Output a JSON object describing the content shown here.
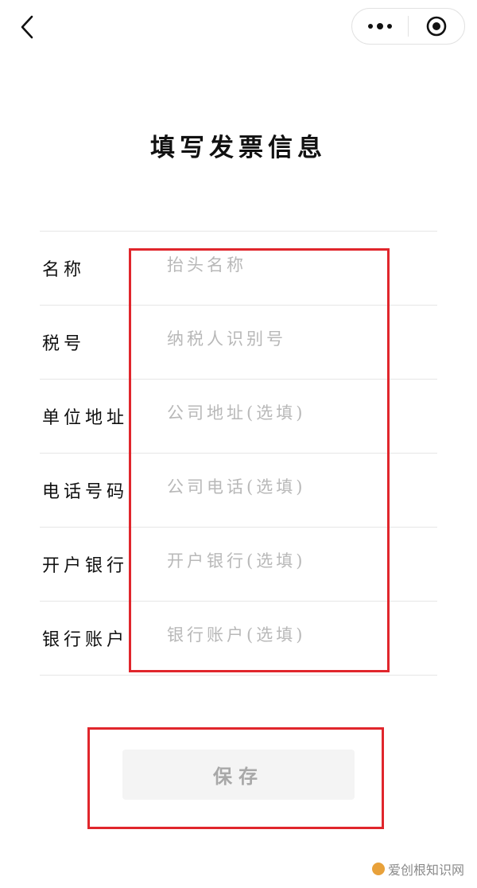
{
  "nav": {
    "back_icon": "chevron-left-icon",
    "more_icon": "more-dots-icon",
    "close_icon": "target-close-icon"
  },
  "page": {
    "title": "填写发票信息"
  },
  "form": {
    "rows": [
      {
        "label": "名称",
        "placeholder": "抬头名称",
        "value": ""
      },
      {
        "label": "税号",
        "placeholder": "纳税人识别号",
        "value": ""
      },
      {
        "label": "单位地址",
        "placeholder": "公司地址(选填)",
        "value": ""
      },
      {
        "label": "电话号码",
        "placeholder": "公司电话(选填)",
        "value": ""
      },
      {
        "label": "开户银行",
        "placeholder": "开户银行(选填)",
        "value": ""
      },
      {
        "label": "银行账户",
        "placeholder": "银行账户(选填)",
        "value": ""
      }
    ]
  },
  "actions": {
    "save_label": "保存"
  },
  "watermark": {
    "text": "爱创根知识网"
  },
  "colors": {
    "highlight": "#e0262c",
    "placeholder": "#b8b8b8",
    "save_bg": "#f4f4f4"
  }
}
